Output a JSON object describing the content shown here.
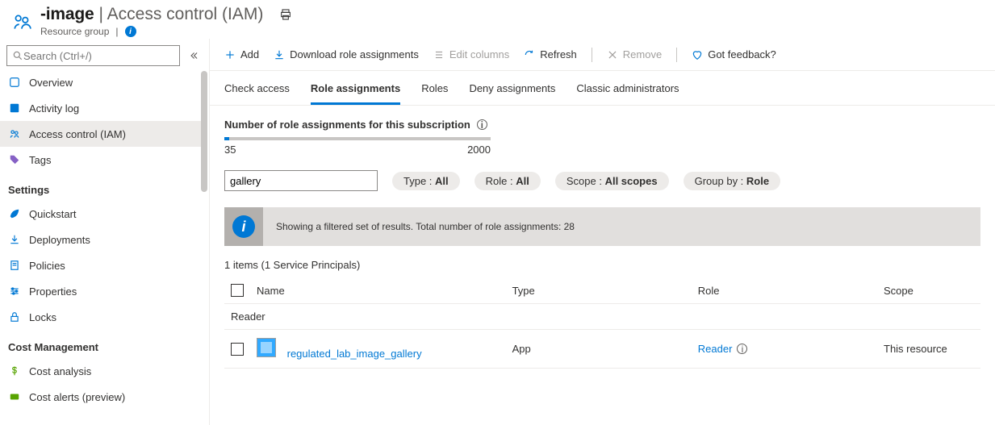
{
  "header": {
    "title": "-image",
    "subtitle": "Access control (IAM)",
    "breadcrumb": "Resource group"
  },
  "search": {
    "placeholder": "Search (Ctrl+/)"
  },
  "sidebar": {
    "items_top": [
      {
        "id": "overview",
        "label": "Overview"
      },
      {
        "id": "activity-log",
        "label": "Activity log"
      },
      {
        "id": "access-control",
        "label": "Access control (IAM)"
      },
      {
        "id": "tags",
        "label": "Tags"
      }
    ],
    "section_settings": "Settings",
    "items_settings": [
      {
        "id": "quickstart",
        "label": "Quickstart"
      },
      {
        "id": "deployments",
        "label": "Deployments"
      },
      {
        "id": "policies",
        "label": "Policies"
      },
      {
        "id": "properties",
        "label": "Properties"
      },
      {
        "id": "locks",
        "label": "Locks"
      }
    ],
    "section_cost": "Cost Management",
    "items_cost": [
      {
        "id": "cost-analysis",
        "label": "Cost analysis"
      },
      {
        "id": "cost-alerts",
        "label": "Cost alerts (preview)"
      }
    ]
  },
  "toolbar": {
    "add": "Add",
    "download": "Download role assignments",
    "edit_columns": "Edit columns",
    "refresh": "Refresh",
    "remove": "Remove",
    "feedback": "Got feedback?"
  },
  "tabs": {
    "check_access": "Check access",
    "role_assignments": "Role assignments",
    "roles": "Roles",
    "deny_assignments": "Deny assignments",
    "classic_admins": "Classic administrators"
  },
  "progress": {
    "title": "Number of role assignments for this subscription",
    "current": "35",
    "max": "2000"
  },
  "filters": {
    "search_value": "gallery",
    "type": {
      "label": "Type : ",
      "value": "All"
    },
    "role": {
      "label": "Role : ",
      "value": "All"
    },
    "scope": {
      "label": "Scope : ",
      "value": "All scopes"
    },
    "groupby": {
      "label": "Group by : ",
      "value": "Role"
    }
  },
  "info_banner": "Showing a filtered set of results. Total number of role assignments: 28",
  "count_line": "1 items (1 Service Principals)",
  "table": {
    "headers": {
      "name": "Name",
      "type": "Type",
      "role": "Role",
      "scope": "Scope"
    },
    "group_label": "Reader",
    "rows": [
      {
        "name": "regulated_lab_image_gallery",
        "type": "App",
        "role": "Reader",
        "scope": "This resource"
      }
    ]
  }
}
